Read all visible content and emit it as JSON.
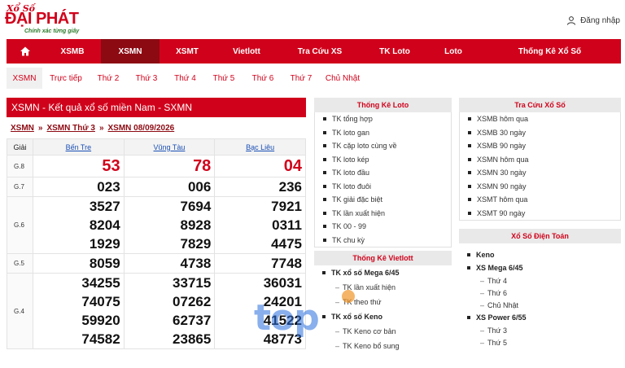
{
  "brand": {
    "line1": "Xổ Số",
    "name": "ĐẠI PHÁT",
    "tagline": "Chính xác từng giây"
  },
  "header": {
    "login_label": "Đăng nhập"
  },
  "main_nav": [
    "XSMB",
    "XSMN",
    "XSMT",
    "Vietlott",
    "Tra Cứu XS",
    "TK Loto",
    "Loto",
    "Thống Kê Xổ Số"
  ],
  "main_nav_active": "XSMN",
  "sub_nav": [
    "XSMN",
    "Trực tiếp",
    "Thứ 2",
    "Thứ 3",
    "Thứ 4",
    "Thứ 5",
    "Thứ 6",
    "Thứ 7",
    "Chủ Nhật"
  ],
  "result": {
    "title": "XSMN - Kết quả xổ số miền Nam - SXMN",
    "breadcrumb": [
      "XSMN",
      "XSMN Thứ 3",
      "XSMN 08/09/2026"
    ],
    "col_prize": "Giải",
    "provinces": [
      "Bến Tre",
      "Vũng Tàu",
      "Bạc Liêu"
    ],
    "rows": [
      {
        "prize": "G.8",
        "values": [
          [
            "53"
          ],
          [
            "78"
          ],
          [
            "04"
          ]
        ]
      },
      {
        "prize": "G.7",
        "values": [
          [
            "023"
          ],
          [
            "006"
          ],
          [
            "236"
          ]
        ]
      },
      {
        "prize": "G.6",
        "values": [
          [
            "3527",
            "8204",
            "1929"
          ],
          [
            "7694",
            "8928",
            "7829"
          ],
          [
            "7921",
            "0311",
            "4475"
          ]
        ]
      },
      {
        "prize": "G.5",
        "values": [
          [
            "8059"
          ],
          [
            "4738"
          ],
          [
            "7748"
          ]
        ]
      },
      {
        "prize": "G.4",
        "values": [
          [
            "34255",
            "74075",
            "59920",
            "74582"
          ],
          [
            "33715",
            "07262",
            "62737",
            "23865"
          ],
          [
            "36031",
            "24201",
            "41522",
            "48773"
          ]
        ]
      }
    ]
  },
  "thong_ke_loto": {
    "title": "Thống Kê Loto",
    "items": [
      "TK tổng hợp",
      "TK loto gan",
      "TK cặp loto cùng về",
      "TK loto kép",
      "TK loto đầu",
      "TK loto đuôi",
      "TK giải đặc biệt",
      "TK lần xuất hiện",
      "TK 00 - 99",
      "TK chu kỳ"
    ]
  },
  "thong_ke_vietlott": {
    "title": "Thống Kê Vietlott",
    "groups": [
      {
        "label": "TK xổ số Mega 6/45",
        "items": [
          "TK lần xuất hiện",
          "TK theo thứ"
        ]
      },
      {
        "label": "TK xổ số Keno",
        "items": [
          "TK Keno cơ bản",
          "TK Keno bổ sung"
        ]
      }
    ]
  },
  "tra_cuu": {
    "title": "Tra Cứu Xổ Số",
    "items": [
      "XSMB hôm qua",
      "XSMB 30 ngày",
      "XSMB 90 ngày",
      "XSMN hôm qua",
      "XSMN 30 ngày",
      "XSMN 90 ngày",
      "XSMT hôm qua",
      "XSMT 90 ngày"
    ]
  },
  "dien_toan": {
    "title": "Xổ Số Điện Toán",
    "groups": [
      {
        "label": "Keno",
        "items": []
      },
      {
        "label": "XS Mega 6/45",
        "items": [
          "Thứ 4",
          "Thứ 6",
          "Chủ Nhật"
        ]
      },
      {
        "label": "XS Power 6/55",
        "items": [
          "Thứ 3",
          "Thứ 5"
        ]
      }
    ]
  },
  "watermark": "top",
  "colors": {
    "brand_red": "#d0021b",
    "dark_red": "#8c0a12",
    "link_blue": "#1a4fb5"
  }
}
